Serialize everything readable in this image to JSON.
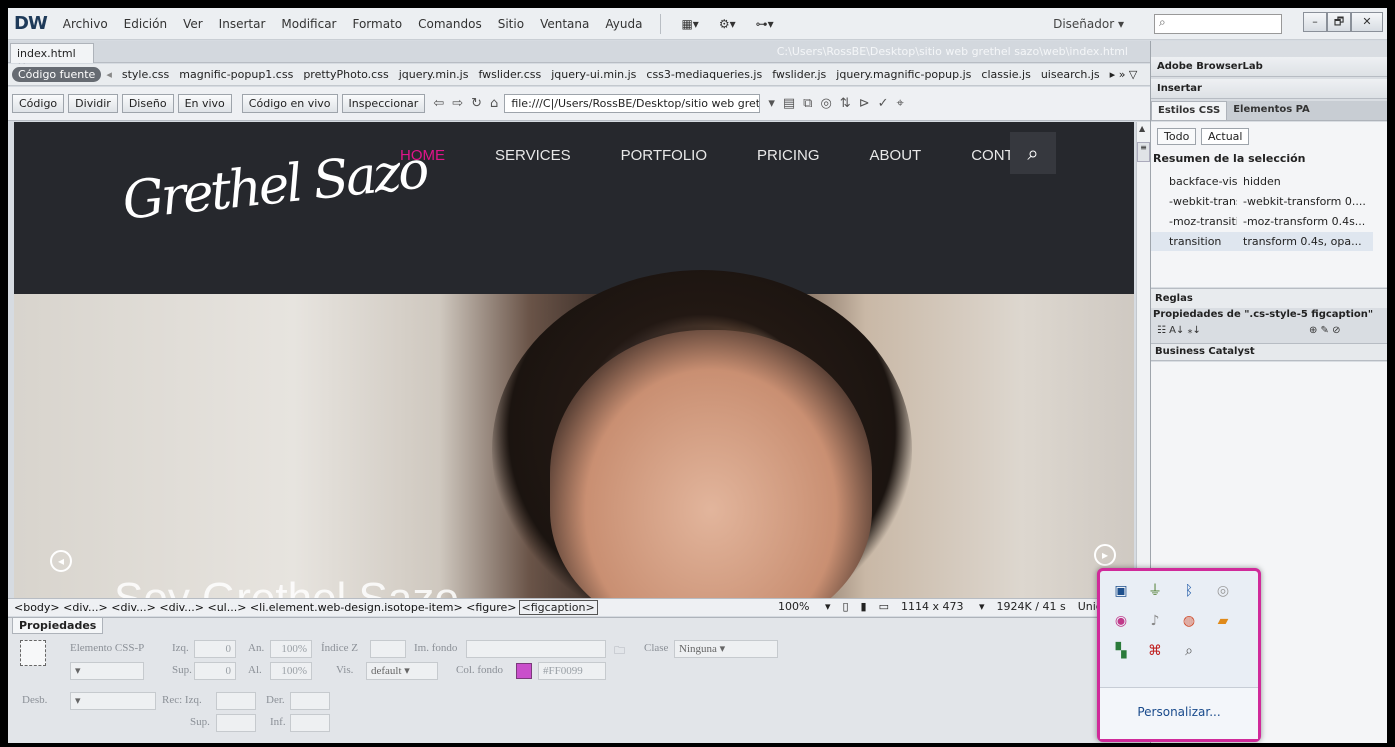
{
  "app": {
    "logo": "DW",
    "menu": [
      "Archivo",
      "Edición",
      "Ver",
      "Insertar",
      "Modificar",
      "Formato",
      "Comandos",
      "Sitio",
      "Ventana",
      "Ayuda"
    ],
    "workspace": "Diseñador",
    "search_placeholder": "",
    "window_buttons": [
      "–",
      "🗗",
      "✕"
    ]
  },
  "document": {
    "tab_label": "index.html ×",
    "path": "C:\\Users\\RossBE\\Desktop\\sitio web grethel sazo\\web\\index.html",
    "source_label": "Código fuente",
    "related_files": [
      "style.css",
      "magnific-popup1.css",
      "prettyPhoto.css",
      "jquery.min.js",
      "fwslider.css",
      "jquery-ui.min.js",
      "css3-mediaqueries.js",
      "fwslider.js",
      "jquery.magnific-popup.js",
      "classie.js",
      "uisearch.js"
    ]
  },
  "toolbar": {
    "buttons": [
      "Código",
      "Dividir",
      "Diseño",
      "En vivo",
      "Código en vivo",
      "Inspeccionar"
    ],
    "address": "file:///C|/Users/RossBE/Desktop/sitio web gretl"
  },
  "site": {
    "nav": [
      "HOME",
      "SERVICES",
      "PORTFOLIO",
      "PRICING",
      "ABOUT",
      "CONTACT"
    ],
    "logo_text": "Grethel Sazo",
    "hero_caption": "Soy Grethel Sazo",
    "accent": "#e0148a"
  },
  "status": {
    "tag_path": "<body> <div...> <div...> <div...> <ul...> <li.element.web-design.isotope-item> <figure>",
    "tag_active": "<figcaption>",
    "zoom": "100%",
    "size": "1114 x 473",
    "weight": "1924K / 41 s",
    "encoding": "Unicode"
  },
  "properties": {
    "tab": "Propiedades",
    "element_label": "Elemento CSS-P",
    "izq_label": "Izq.",
    "izq": "0",
    "an_label": "An.",
    "an": "100%",
    "indice_label": "Índice Z",
    "indice": "",
    "imfondo_label": "Im. fondo",
    "imfondo": "",
    "clase_label": "Clase",
    "clase": "Ninguna",
    "sup_label": "Sup.",
    "sup": "0",
    "al_label": "Al.",
    "al": "100%",
    "vis_label": "Vis.",
    "vis": "default",
    "colfondo_label": "Col. fondo",
    "colfondo": "#FF0099",
    "desb_label": "Desb.",
    "rec_label": "Rec: Izq.",
    "der_label": "Der.",
    "sup2_label": "Sup.",
    "inf_label": "Inf."
  },
  "panel": {
    "browserlab": "Adobe BrowserLab",
    "insertar": "Insertar",
    "tabs": [
      "Estilos CSS",
      "Elementos PA"
    ],
    "modes": [
      "Todo",
      "Actual"
    ],
    "summary_title": "Resumen de la selección",
    "rows": [
      {
        "k": "backface-visib...",
        "v": "hidden"
      },
      {
        "k": "-webkit-transi...",
        "v": "-webkit-transform 0...."
      },
      {
        "k": "-moz-transition",
        "v": "-moz-transform 0.4s..."
      },
      {
        "k": "transition",
        "v": "transform 0.4s, opa..."
      }
    ],
    "reglas": "Reglas",
    "props_de": "Propiedades de \".cs-style-5 figcaption\"",
    "business": "Business Catalyst"
  },
  "tray": {
    "customize": "Personalizar...",
    "icons": [
      "monitor-icon",
      "usb-icon",
      "bluetooth-icon",
      "wireless-icon",
      "color-wheel-icon",
      "bell-icon",
      "chrome-icon",
      "adobe-updater-icon",
      "windows-icon",
      "acrobat-icon",
      "magnifier-icon"
    ]
  }
}
